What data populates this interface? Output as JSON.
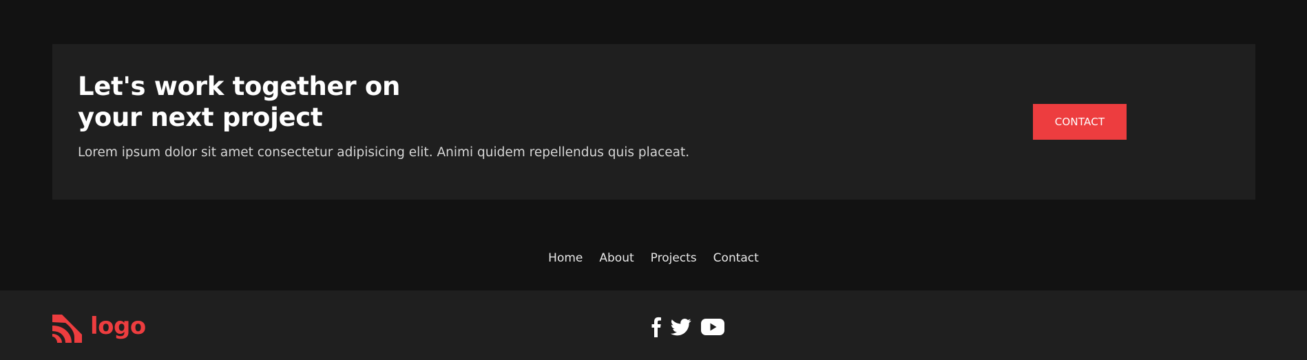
{
  "cta": {
    "title": "Let's work together on your next project",
    "text": "Lorem ipsum dolor sit amet consectetur adipisicing elit. Animi quidem repellendus quis placeat.",
    "button_label": "CONTACT"
  },
  "nav": {
    "items": [
      {
        "label": "Home"
      },
      {
        "label": "About"
      },
      {
        "label": "Projects"
      },
      {
        "label": "Contact"
      }
    ]
  },
  "footer": {
    "logo_text": "logo",
    "social_icons": [
      "facebook-icon",
      "twitter-icon",
      "youtube-icon"
    ]
  },
  "colors": {
    "background": "#121212",
    "card": "#1f1f1f",
    "accent": "#ed3d3f",
    "text": "#ffffff",
    "muted_text": "#d6d6d6"
  }
}
